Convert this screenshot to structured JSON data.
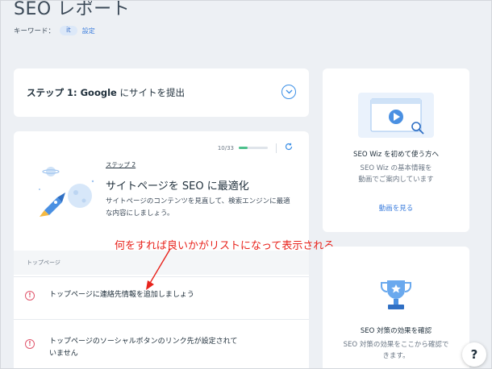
{
  "header": {
    "title": "SEO レポート",
    "keyword_label": "キーワード：",
    "keyword_value": "it",
    "settings_link": "設定"
  },
  "step1": {
    "prefix": "ステップ 1: ",
    "brand": "Google",
    "suffix": " にサイトを提出"
  },
  "step2": {
    "progress_text": "10/33",
    "progress_fraction": 0.303,
    "step_label": "ステップ 2",
    "title": "サイトページを SEO に最適化",
    "description": "サイトページのコンテンツを見直して、検索エンジンに最適な内容にしましょう。",
    "section_label": "トップページ",
    "items": [
      {
        "text": "トップページに連絡先情報を追加しましょう"
      },
      {
        "text": "トップページのソーシャルボタンのリンク先が設定されていません"
      }
    ]
  },
  "annotation": "何をすれば良いかがリストになって表示される",
  "right_cards": [
    {
      "title": "SEO Wiz を初めて使う方へ",
      "description_line1": "SEO Wiz の基本情報を",
      "description_line2": "動画でご案内しています",
      "link": "動画を見る"
    },
    {
      "title": "SEO 対策の効果を確認",
      "description_line1": "SEO 対策の効果をここから確認で",
      "description_line2": "きます。"
    }
  ],
  "help_button": "?",
  "colors": {
    "accent": "#3b8fe6",
    "progress": "#4cc08c",
    "warning": "#e0566c",
    "annotation": "#e8231c"
  },
  "icons": [
    "chevron-down-icon",
    "refresh-icon",
    "alert-icon",
    "video-icon",
    "trophy-icon",
    "rocket-icon",
    "help-icon"
  ]
}
